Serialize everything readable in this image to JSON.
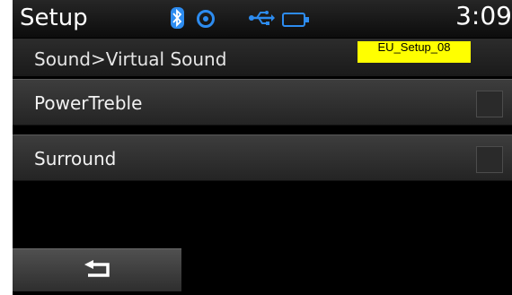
{
  "status_bar": {
    "title": "Setup",
    "time": "3:09",
    "icons": [
      "bluetooth-icon",
      "disc-icon",
      "usb-icon",
      "battery-icon"
    ],
    "accent_color": "#2d8cf0"
  },
  "breadcrumb": {
    "text": "Sound>Virtual Sound"
  },
  "code_tag": {
    "text": "EU_Setup_08",
    "color": "#ffff00"
  },
  "menu": {
    "items": [
      {
        "label": "PowerTreble",
        "checked": false
      },
      {
        "label": "Surround",
        "checked": false
      }
    ]
  },
  "back_button": {
    "icon": "back-arrow-icon"
  }
}
